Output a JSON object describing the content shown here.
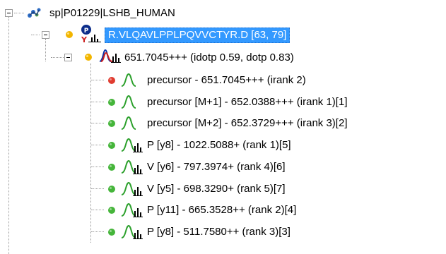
{
  "tree": {
    "protein": {
      "label": "sp|P01229|LSHB_HUMAN",
      "icon": "protein-icon"
    },
    "peptide": {
      "label": "R.VLQAVLPPLPQVVCTYR.D [63, 79]",
      "icon": "peptide-icon",
      "status_dot_color": "#f2b500",
      "selected_color": "#3399ff"
    },
    "precursor_group": {
      "label": "651.7045+++ (idotp 0.59, dotp 0.83)",
      "icon": "precursor-spectrum-icon",
      "status_dot_color": "#f2b500"
    },
    "transitions": [
      {
        "label": "precursor - 651.7045+++ (irank 2)",
        "dot_color": "#e03b2f",
        "icon": "peak-icon"
      },
      {
        "label": "precursor [M+1] - 652.0388+++ (irank 1)[1]",
        "dot_color": "#45b53a",
        "icon": "peak-icon"
      },
      {
        "label": "precursor [M+2] - 652.3729+++ (irank 3)[2]",
        "dot_color": "#45b53a",
        "icon": "peak-icon"
      },
      {
        "label": "P [y8] - 1022.5088+ (rank 1)[5]",
        "dot_color": "#45b53a",
        "icon": "fragment-peak-icon"
      },
      {
        "label": "V [y6] - 797.3974+ (rank 4)[6]",
        "dot_color": "#45b53a",
        "icon": "fragment-peak-icon"
      },
      {
        "label": "V [y5] - 698.3290+ (rank 5)[7]",
        "dot_color": "#45b53a",
        "icon": "fragment-peak-icon"
      },
      {
        "label": "P [y11] - 665.3528++ (rank 2)[4]",
        "dot_color": "#45b53a",
        "icon": "fragment-peak-icon"
      },
      {
        "label": "P [y8] - 511.7580++ (rank 3)[3]",
        "dot_color": "#45b53a",
        "icon": "fragment-peak-icon"
      }
    ]
  }
}
